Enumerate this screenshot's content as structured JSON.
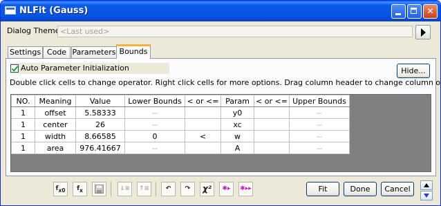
{
  "window": {
    "title": "NLFit (Gauss)"
  },
  "dialog_theme": {
    "label": "Dialog Theme",
    "value": "<Last used>"
  },
  "tabs": [
    {
      "label": "Settings"
    },
    {
      "label": "Code"
    },
    {
      "label": "Parameters"
    },
    {
      "label": "Bounds",
      "active": true
    }
  ],
  "bounds": {
    "auto_init_label": "Auto Parameter Initialization",
    "auto_init_checked": true,
    "hide_button": "Hide...",
    "instructions": "Double click cells to change operator. Right click cells for more options. Drag column header to change column orders.",
    "columns": [
      "NO.",
      "Meaning",
      "Value",
      "Lower Bounds",
      "< or <=",
      "Param",
      "< or <=",
      "Upper Bounds"
    ],
    "rows": [
      {
        "no": "1",
        "meaning": "offset",
        "value": "5.58333",
        "lower": "--",
        "op1": "",
        "param": "y0",
        "op2": "",
        "upper": "--"
      },
      {
        "no": "1",
        "meaning": "center",
        "value": "26",
        "lower": "--",
        "op1": "",
        "param": "xc",
        "op2": "",
        "upper": "--"
      },
      {
        "no": "1",
        "meaning": "width",
        "value": "8.66585",
        "lower": "0",
        "op1": "<",
        "param": "w",
        "op2": "",
        "upper": "--"
      },
      {
        "no": "1",
        "meaning": "area",
        "value": "976.41667",
        "lower": "--",
        "op1": "",
        "param": "A",
        "op2": "",
        "upper": "--"
      }
    ]
  },
  "toolbar": {
    "icons": [
      "fx0",
      "fx",
      "save",
      "sort-down",
      "sort-up",
      "undo",
      "redo",
      "chi-square",
      "iterate-one",
      "iterate-all"
    ],
    "chi2_label": "χ²"
  },
  "buttons": {
    "fit": "Fit",
    "done": "Done",
    "cancel": "Cancel"
  },
  "colors": {
    "title_bar": "#0655e6",
    "tab_active_accent": "#f8b33b",
    "dialog_bg": "#ece9d8"
  }
}
